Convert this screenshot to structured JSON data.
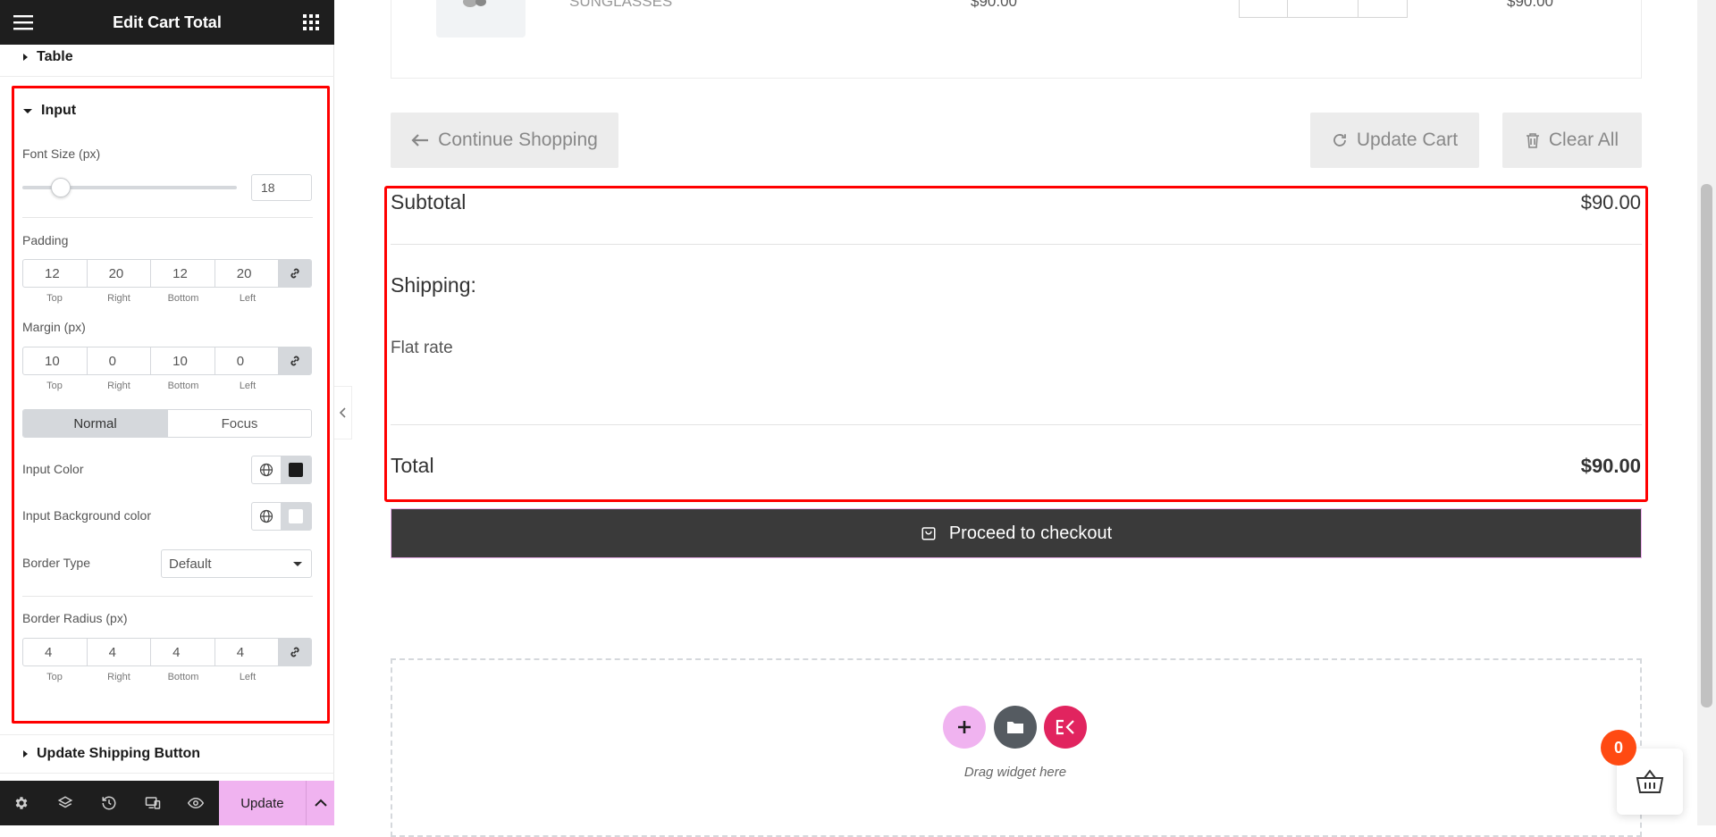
{
  "panel": {
    "title": "Edit Cart Total",
    "sections": {
      "table": "Table",
      "input": "Input",
      "update_shipping": "Update Shipping Button"
    },
    "font_size": {
      "label": "Font Size (px)",
      "value": "18",
      "slider_fraction": 0.18
    },
    "padding": {
      "label": "Padding",
      "top": "12",
      "right": "20",
      "bottom": "12",
      "left": "20"
    },
    "margin": {
      "label": "Margin (px)",
      "top": "10",
      "right": "0",
      "bottom": "10",
      "left": "0"
    },
    "dim_labels": {
      "top": "Top",
      "right": "Right",
      "bottom": "Bottom",
      "left": "Left"
    },
    "state_tabs": {
      "normal": "Normal",
      "focus": "Focus"
    },
    "input_color": {
      "label": "Input Color",
      "value": "#1a1a1a"
    },
    "input_bg_color": {
      "label": "Input Background color",
      "value": "#ffffff"
    },
    "border_type": {
      "label": "Border Type",
      "value": "Default"
    },
    "border_radius": {
      "label": "Border Radius (px)",
      "top": "4",
      "right": "4",
      "bottom": "4",
      "left": "4"
    },
    "footer": {
      "update_label": "Update"
    }
  },
  "main": {
    "product_name_partial": "SUNGLASSES",
    "price_partial": "$90.00",
    "line_total_partial": "$90.00",
    "continue_shopping": "Continue Shopping",
    "update_cart": "Update Cart",
    "clear_all": "Clear All",
    "subtotal_label": "Subtotal",
    "subtotal_value": "$90.00",
    "shipping_label": "Shipping:",
    "shipping_method": "Flat rate",
    "total_label": "Total",
    "total_value": "$90.00",
    "checkout_label": "Proceed to checkout",
    "drag_text": "Drag widget here",
    "cart_count": "0"
  },
  "colors": {
    "accent": "#f0b3f0",
    "highlight": "#ff0000",
    "badge": "#ff4a12",
    "dark": "#1e1e1e"
  }
}
